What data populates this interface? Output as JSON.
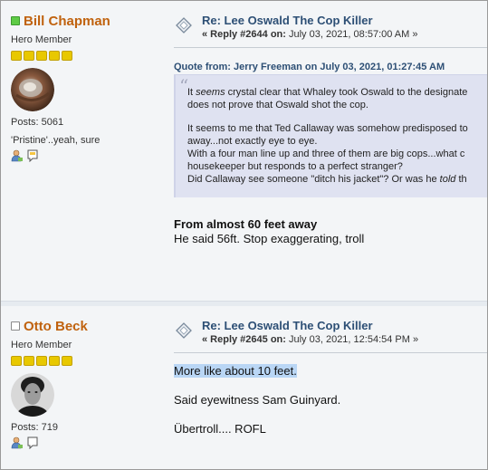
{
  "posts": [
    {
      "author": "Bill Chapman",
      "status": "online",
      "rank": "Hero Member",
      "post_count": "Posts: 5061",
      "tagline": "'Pristine'..yeah, sure",
      "subject": "Re: Lee Oswald The Cop Killer",
      "reply_label": "« Reply #2644 on:",
      "reply_date": " July 03, 2021, 08:57:00 AM »",
      "quote_header": "Quote from: Jerry Freeman on July 03, 2021, 01:27:45 AM",
      "quote_lines": [
        "It seems crystal clear that Whaley took Oswald to the designate",
        "does not prove that Oswald shot the cop.",
        "It seems to me that Ted Callaway was somehow predisposed to",
        "away...not exactly eye to eye.",
        "With a four man line up and three of them are big cops...what c",
        "housekeeper but responds to a perfect stranger?",
        "Did Callaway see someone \"ditch his jacket\"? Or was he told th"
      ],
      "body_bold": "From almost 60 feet away",
      "body_text": "He said 56ft. Stop exaggerating, troll"
    },
    {
      "author": "Otto Beck",
      "status": "offline",
      "rank": "Hero Member",
      "post_count": "Posts: 719",
      "subject": "Re: Lee Oswald The Cop Killer",
      "reply_label": "« Reply #2645 on:",
      "reply_date": " July 03, 2021, 12:54:54 PM »",
      "body_lines": [
        "More like about 10 feet.",
        "Said eyewitness Sam Guinyard.",
        "Übertroll.... ROFL"
      ]
    }
  ],
  "colors": {
    "author": "#c0620e",
    "subject": "#2d4f75",
    "quote_bg": "#dfe2f1",
    "highlight": "#b9d6f5",
    "star": "#e8c800"
  },
  "stars_count": 5,
  "icons": [
    "online-status-icon",
    "offline-status-icon",
    "topic-icon",
    "profile-icon",
    "personal-message-icon",
    "avatar"
  ]
}
